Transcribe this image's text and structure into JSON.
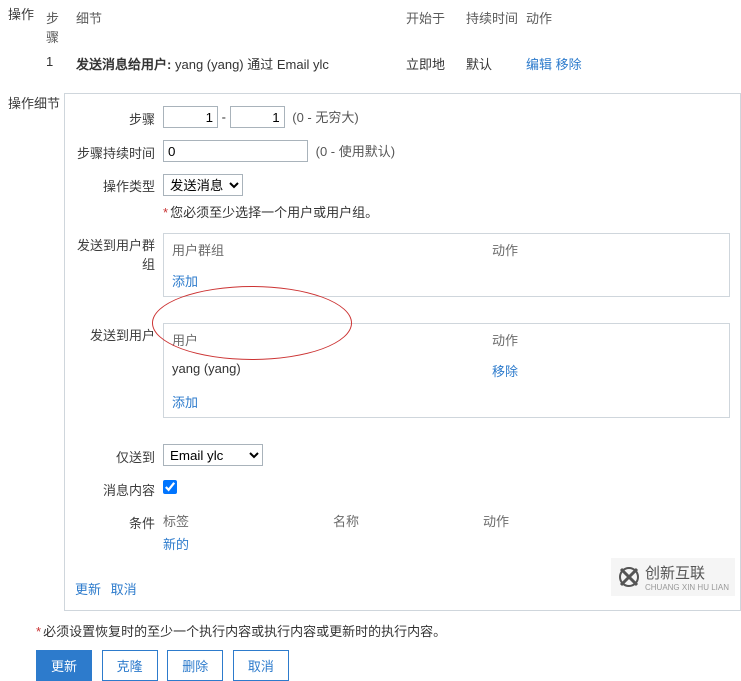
{
  "ops": {
    "label": "操作",
    "headers": {
      "step": "步骤",
      "detail": "细节",
      "start": "开始于",
      "dur": "持续时间",
      "act": "动作"
    },
    "row": {
      "step": "1",
      "detail_label": "发送消息给用户:",
      "detail_value": "yang (yang) 通过 Email ylc",
      "start": "立即地",
      "dur": "默认",
      "edit": "编辑",
      "remove": "移除"
    }
  },
  "details": {
    "label": "操作细节",
    "step": {
      "label": "步骤",
      "from": "1",
      "to": "1",
      "hint": "(0 - 无穷大)"
    },
    "stepdur": {
      "label": "步骤持续时间",
      "value": "0",
      "hint": "(0 - 使用默认)"
    },
    "optype": {
      "label": "操作类型",
      "selected": "发送消息"
    },
    "validation": "您必须至少选择一个用户或用户组。",
    "group": {
      "label": "发送到用户群组",
      "col_main": "用户群组",
      "col_act": "动作",
      "add": "添加"
    },
    "user": {
      "label": "发送到用户",
      "col_main": "用户",
      "col_act": "动作",
      "entry": "yang (yang)",
      "remove": "移除",
      "add": "添加"
    },
    "sendto": {
      "label": "仅送到",
      "selected": "Email ylc"
    },
    "msg": {
      "label": "消息内容",
      "checked": true
    },
    "cond": {
      "label": "条件",
      "col_tag": "标签",
      "col_name": "名称",
      "col_act": "动作",
      "new": "新的"
    },
    "footer": {
      "update": "更新",
      "cancel": "取消"
    }
  },
  "bottom": {
    "warn": "必须设置恢复时的至少一个执行内容或执行内容或更新时的执行内容。",
    "update": "更新",
    "clone": "克隆",
    "delete": "删除",
    "cancel": "取消"
  },
  "logo": {
    "cn": "创新互联",
    "py": "CHUANG XIN HU LIAN"
  }
}
